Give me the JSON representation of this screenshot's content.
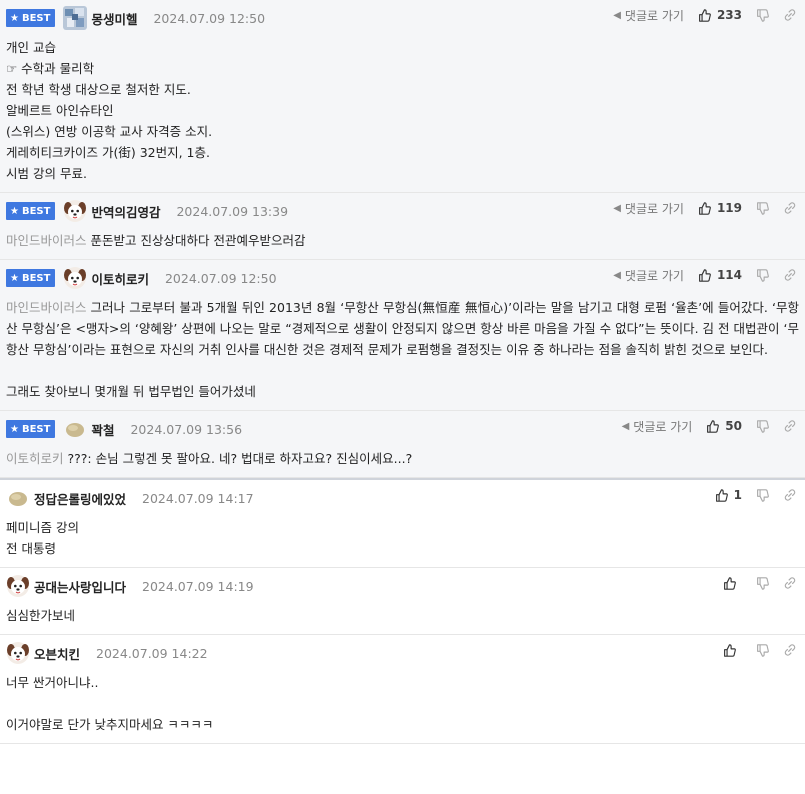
{
  "best_label": "BEST",
  "reply_label": "댓글로 가기",
  "comments": [
    {
      "best": true,
      "avatar": "mosaic-avatar",
      "nick": "몽생미헬",
      "date": "2024.07.09 12:50",
      "likes": "233",
      "mention": "",
      "lines": [
        "개인 교습",
        "☞ 수학과 물리학",
        "전 학년 학생 대상으로 철저한 지도.",
        "알베르트 아인슈타인",
        "(스위스) 연방 이공학 교사 자격증 소지.",
        "게레히티크카이즈 가(街) 32번지, 1층.",
        "시범 강의 무료."
      ]
    },
    {
      "best": true,
      "avatar": "dog-avatar",
      "nick": "반역의김영감",
      "date": "2024.07.09 13:39",
      "likes": "119",
      "mention": "마인드바이러스",
      "lines": [
        "푼돈받고 진상상대하다 전관예우받으러감"
      ]
    },
    {
      "best": true,
      "avatar": "dog-avatar",
      "nick": "이토히로키",
      "date": "2024.07.09 12:50",
      "likes": "114",
      "mention": "마인드바이러스",
      "lines": [
        "그러나 그로부터 불과 5개월 뒤인 2013년 8월 ‘무항산 무항심(無恒産 無恒心)’이라는 말을 남기고 대형 로펌 ‘율촌’에 들어갔다. ‘무항산 무항심’은 <맹자>의 ‘양혜왕’ 상편에 나오는 말로 “경제적으로 생활이 안정되지 않으면 항상 바른 마음을 가질 수 없다”는 뜻이다. 김 전 대법관이 ‘무항산 무항심’이라는 표현으로 자신의 거취 인사를 대신한 것은 경제적 문제가 로펌행을 결정짓는 이유 중 하나라는 점을 솔직히 밝힌 것으로 보인다.",
        "",
        "그래도 찾아보니 몇개월 뒤 법무법인 들어가셨네"
      ]
    },
    {
      "best": true,
      "avatar": "stone-avatar",
      "nick": "꽉철",
      "date": "2024.07.09 13:56",
      "likes": "50",
      "mention": "이토히로키",
      "lines": [
        "???: 손님 그렇겐 못 팔아요. 네? 법대로 하자고요? 진심이세요...?"
      ]
    },
    {
      "best": false,
      "avatar": "stone-avatar",
      "nick": "정답은롤링에있었",
      "date": "2024.07.09 14:17",
      "likes": "1",
      "mention": "",
      "lines": [
        "페미니즘 강의",
        "전 대통령"
      ]
    },
    {
      "best": false,
      "avatar": "dog-avatar",
      "nick": "공대는사랑입니다",
      "date": "2024.07.09 14:19",
      "likes": "",
      "mention": "",
      "lines": [
        "심심한가보네"
      ]
    },
    {
      "best": false,
      "avatar": "dog-avatar",
      "nick": "오븐치킨",
      "date": "2024.07.09 14:22",
      "likes": "",
      "mention": "",
      "lines": [
        "너무 싼거아니냐..",
        "",
        "이거야말로 단가 낮추지마세요 ㅋㅋㅋㅋ"
      ]
    }
  ]
}
